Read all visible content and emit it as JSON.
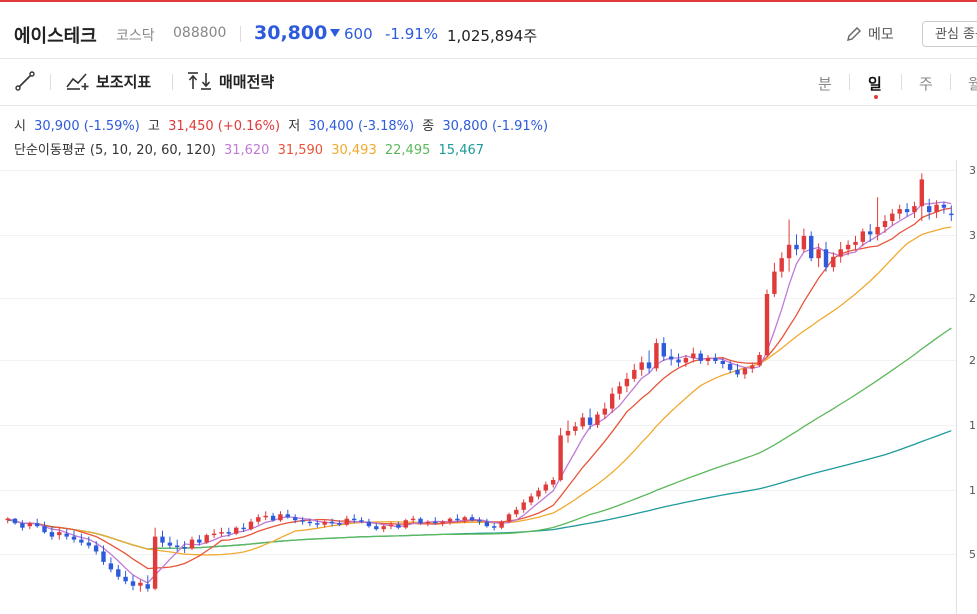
{
  "header": {
    "stock_name": "에이스테크",
    "market": "코스닥",
    "code": "088800",
    "price": "30,800",
    "change": "600",
    "change_rate": "-1.91%",
    "volume": "1,025,894주",
    "memo_label": "메모",
    "favorite_label": "관심 종목"
  },
  "toolbar": {
    "aux_label": "보조지표",
    "trade_label": "매매전략",
    "periods": [
      "분",
      "일",
      "주",
      "월"
    ],
    "active_period": "일"
  },
  "ohlc": {
    "open_label": "시",
    "open_value": "30,900 (-1.59%)",
    "high_label": "고",
    "high_value": "31,450 (+0.16%)",
    "low_label": "저",
    "low_value": "30,400 (-3.18%)",
    "close_label": "종",
    "close_value": "30,800 (-1.91%)"
  },
  "ma": {
    "label": "단순이동평균 (5, 10, 20, 60, 120)",
    "ma5": "31,620",
    "ma10": "31,590",
    "ma20": "30,493",
    "ma60": "22,495",
    "ma120": "15,467"
  },
  "colors": {
    "up": "#e03a3a",
    "down": "#2e5bdb",
    "ma5": "#c07ad8",
    "ma10": "#e8553a",
    "ma20": "#f0aa30",
    "ma60": "#5cb85c",
    "ma120": "#1e9a9a"
  },
  "chart_data": {
    "type": "candlestick",
    "y_ticks": [
      "3",
      "3",
      "2",
      "2",
      "1",
      "1",
      "5"
    ],
    "ylim": [
      4000,
      34500
    ],
    "candles": [
      [
        10300,
        10500,
        10100,
        10400
      ],
      [
        10400,
        10450,
        10000,
        10100
      ],
      [
        10100,
        10300,
        9600,
        9800
      ],
      [
        9900,
        10200,
        9700,
        10100
      ],
      [
        10100,
        10400,
        9800,
        9900
      ],
      [
        9900,
        10200,
        9400,
        9500
      ],
      [
        9500,
        9900,
        9000,
        9200
      ],
      [
        9300,
        9800,
        9000,
        9500
      ],
      [
        9400,
        9700,
        9000,
        9200
      ],
      [
        9200,
        9600,
        8800,
        9000
      ],
      [
        9000,
        9400,
        8600,
        8800
      ],
      [
        8800,
        9200,
        8400,
        8600
      ],
      [
        8600,
        8900,
        8000,
        8200
      ],
      [
        8200,
        8600,
        7300,
        7500
      ],
      [
        7400,
        7800,
        6800,
        7000
      ],
      [
        7000,
        7300,
        6300,
        6500
      ],
      [
        6500,
        6900,
        6000,
        6200
      ],
      [
        6200,
        6600,
        5600,
        5900
      ],
      [
        5900,
        6300,
        5500,
        6100
      ],
      [
        6000,
        6600,
        5500,
        5700
      ],
      [
        5700,
        9800,
        5600,
        9200
      ],
      [
        9200,
        9600,
        8500,
        8800
      ],
      [
        8800,
        9200,
        8400,
        8600
      ],
      [
        8600,
        9000,
        8200,
        8500
      ],
      [
        8500,
        8900,
        8100,
        8400
      ],
      [
        8400,
        9200,
        8300,
        9000
      ],
      [
        9000,
        9300,
        8600,
        8800
      ],
      [
        8800,
        9400,
        8700,
        9300
      ],
      [
        9300,
        9700,
        9100,
        9400
      ],
      [
        9400,
        9800,
        9200,
        9500
      ],
      [
        9500,
        9800,
        9200,
        9400
      ],
      [
        9400,
        9900,
        9300,
        9800
      ],
      [
        9800,
        10100,
        9500,
        9700
      ],
      [
        9700,
        10400,
        9600,
        10200
      ],
      [
        10200,
        10700,
        10000,
        10500
      ],
      [
        10500,
        10900,
        10300,
        10600
      ],
      [
        10600,
        10800,
        10200,
        10300
      ],
      [
        10300,
        10900,
        10200,
        10700
      ],
      [
        10700,
        11000,
        10400,
        10500
      ],
      [
        10500,
        10700,
        10100,
        10300
      ],
      [
        10300,
        10500,
        10000,
        10200
      ],
      [
        10200,
        10400,
        9900,
        10100
      ],
      [
        10100,
        10300,
        9800,
        10000
      ],
      [
        10000,
        10300,
        9800,
        10200
      ],
      [
        10200,
        10400,
        9900,
        10100
      ],
      [
        10100,
        10300,
        9900,
        10000
      ],
      [
        10000,
        10600,
        9900,
        10400
      ],
      [
        10400,
        10700,
        10100,
        10300
      ],
      [
        10300,
        10500,
        10100,
        10200
      ],
      [
        10200,
        10400,
        9800,
        9900
      ],
      [
        9900,
        10100,
        9600,
        9700
      ],
      [
        9700,
        10000,
        9500,
        9900
      ],
      [
        9900,
        10200,
        9700,
        10000
      ],
      [
        10000,
        10200,
        9700,
        9800
      ],
      [
        9800,
        10400,
        9700,
        10300
      ],
      [
        10300,
        10600,
        10100,
        10400
      ],
      [
        10400,
        10500,
        10000,
        10100
      ],
      [
        10100,
        10300,
        9900,
        10200
      ],
      [
        10200,
        10500,
        10000,
        10100
      ],
      [
        10100,
        10300,
        9900,
        10200
      ],
      [
        10200,
        10500,
        10000,
        10400
      ],
      [
        10400,
        10700,
        10200,
        10300
      ],
      [
        10300,
        10600,
        10100,
        10500
      ],
      [
        10500,
        10700,
        10200,
        10300
      ],
      [
        10300,
        10500,
        10000,
        10200
      ],
      [
        10200,
        10400,
        9800,
        9900
      ],
      [
        9900,
        10100,
        9600,
        9800
      ],
      [
        9800,
        10300,
        9700,
        10200
      ],
      [
        10200,
        10800,
        10100,
        10700
      ],
      [
        10700,
        11200,
        10500,
        11000
      ],
      [
        11000,
        11700,
        10800,
        11500
      ],
      [
        11500,
        12100,
        11300,
        11900
      ],
      [
        11900,
        12500,
        11700,
        12300
      ],
      [
        12300,
        12900,
        12100,
        12700
      ],
      [
        12700,
        13200,
        12500,
        13000
      ],
      [
        13000,
        16500,
        12900,
        16000
      ],
      [
        16000,
        17000,
        15500,
        16300
      ],
      [
        16300,
        16900,
        16000,
        16600
      ],
      [
        16600,
        17500,
        16400,
        17200
      ],
      [
        17200,
        17800,
        16400,
        16700
      ],
      [
        16700,
        17600,
        16500,
        17400
      ],
      [
        17400,
        18200,
        17100,
        17800
      ],
      [
        17800,
        19200,
        17500,
        18800
      ],
      [
        18800,
        19600,
        18400,
        19300
      ],
      [
        19300,
        20200,
        18900,
        19800
      ],
      [
        19800,
        20800,
        19600,
        20400
      ],
      [
        20400,
        21300,
        20000,
        20900
      ],
      [
        20900,
        21700,
        20200,
        20500
      ],
      [
        20500,
        22500,
        20300,
        22200
      ],
      [
        22200,
        22600,
        21000,
        21300
      ],
      [
        21300,
        21800,
        20700,
        21100
      ],
      [
        21100,
        21500,
        20600,
        20900
      ],
      [
        20900,
        21400,
        20600,
        21200
      ],
      [
        21200,
        21900,
        20900,
        21500
      ],
      [
        21500,
        21700,
        20800,
        21000
      ],
      [
        21000,
        21400,
        20700,
        21200
      ],
      [
        21200,
        21500,
        20800,
        21000
      ],
      [
        21000,
        21200,
        20500,
        20800
      ],
      [
        20800,
        21000,
        20200,
        20400
      ],
      [
        20400,
        20800,
        19900,
        20100
      ],
      [
        20100,
        20600,
        19800,
        20500
      ],
      [
        20500,
        20900,
        20200,
        20700
      ],
      [
        20700,
        21600,
        20600,
        21400
      ],
      [
        21400,
        25800,
        21300,
        25500
      ],
      [
        25500,
        27600,
        25300,
        27000
      ],
      [
        27000,
        28300,
        26600,
        27900
      ],
      [
        27900,
        30500,
        27000,
        28800
      ],
      [
        28800,
        29500,
        28100,
        28500
      ],
      [
        28500,
        29900,
        28300,
        29400
      ],
      [
        29400,
        29700,
        27700,
        27900
      ],
      [
        27900,
        28900,
        27300,
        28500
      ],
      [
        28500,
        29000,
        27000,
        27300
      ],
      [
        27300,
        28300,
        27000,
        28000
      ],
      [
        28000,
        29000,
        27600,
        28500
      ],
      [
        28500,
        29100,
        28100,
        28800
      ],
      [
        28800,
        29400,
        28400,
        29000
      ],
      [
        29000,
        29900,
        28700,
        29700
      ],
      [
        29700,
        30200,
        29000,
        29500
      ],
      [
        29500,
        32000,
        29100,
        30000
      ],
      [
        30000,
        30800,
        29600,
        30400
      ],
      [
        30400,
        31200,
        30100,
        30900
      ],
      [
        30900,
        31500,
        30500,
        31200
      ],
      [
        31200,
        31600,
        30700,
        31000
      ],
      [
        31000,
        31700,
        30600,
        31400
      ],
      [
        31400,
        33600,
        30400,
        33200
      ],
      [
        31400,
        31900,
        30500,
        31000
      ],
      [
        31000,
        31800,
        30600,
        31500
      ],
      [
        31500,
        31700,
        30900,
        31300
      ],
      [
        30900,
        31450,
        30400,
        30800
      ]
    ],
    "ma5": [],
    "ma10": [],
    "ma20": [],
    "ma60": [],
    "ma120": []
  }
}
